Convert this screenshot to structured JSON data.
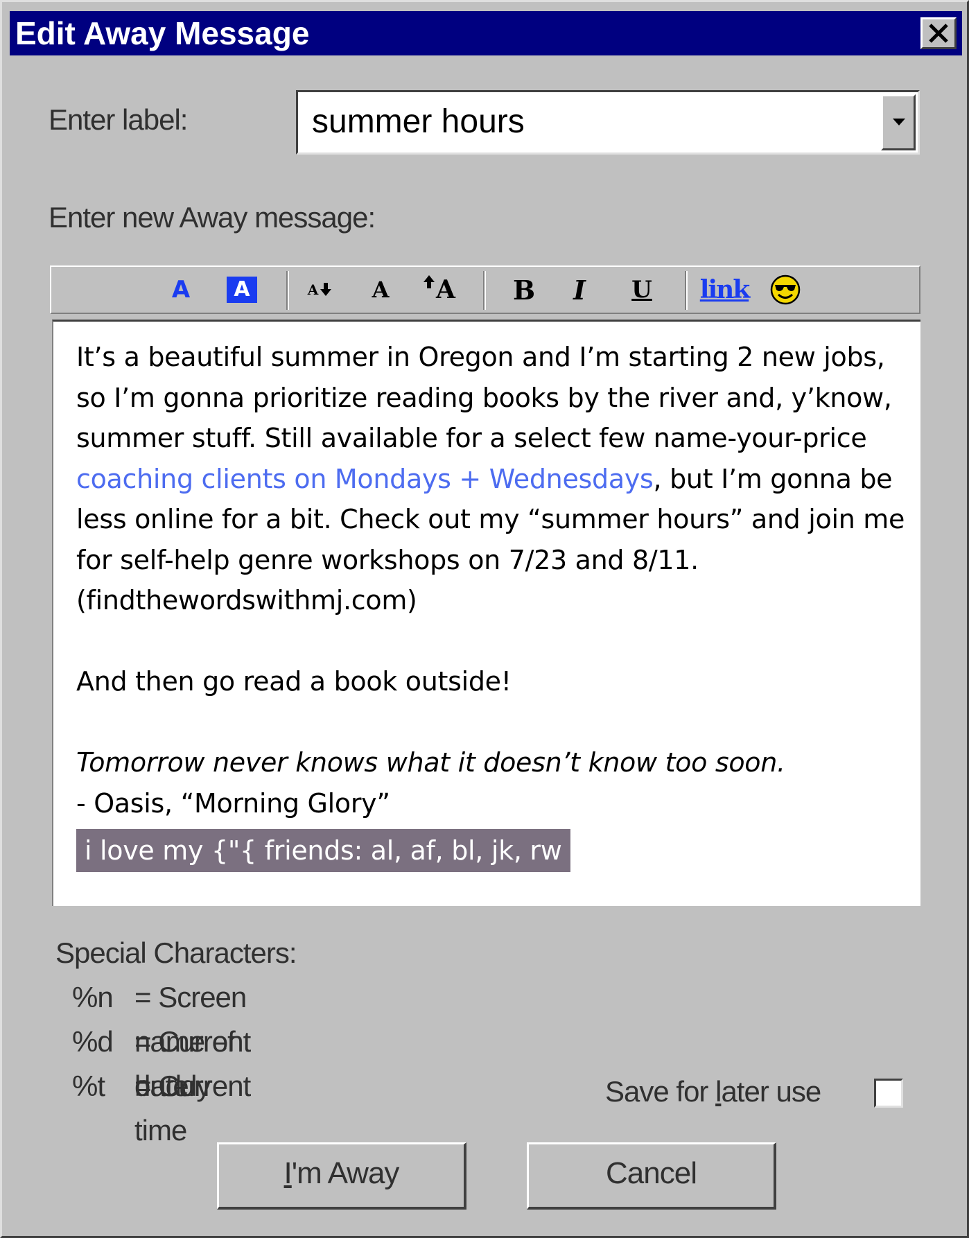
{
  "window": {
    "title": "Edit Away Message"
  },
  "label_field": {
    "caption": "Enter label:",
    "value": "summer hours"
  },
  "message_caption": "Enter new Away message:",
  "toolbar": {
    "text_color": "A",
    "bg_color": "A",
    "smaller_font": "A",
    "normal_font": "A",
    "larger_font": "A",
    "bold": "B",
    "italic": "I",
    "underline": "U",
    "link": "link"
  },
  "message": {
    "para1_a": "It’s a beautiful summer in Oregon and I’m starting 2 new jobs, so I’m gonna prioritize reading books by the river and, y’know, summer stuff. Still available for a select few name-your-price ",
    "para1_link": "coaching clients on Mondays + Wednesdays",
    "para1_b": ", but I’m gonna be less online for a bit. Check out my “summer hours” and join me for self-help genre workshops on 7/23 and 8/11. (findthewordswithmj.com)",
    "para2": "And then go read a book outside!",
    "quote_line": "Tomorrow never knows what it doesn’t know too soon.",
    "quote_attr": "- Oasis, “Morning Glory”",
    "tagline": "i love my {\"{ friends: al, af, bl, jk, rw"
  },
  "special": {
    "heading": "Special Characters:",
    "items": [
      {
        "code": "%n",
        "desc": "= Screen name of buddy"
      },
      {
        "code": "%d",
        "desc": "= Current date"
      },
      {
        "code": "%t",
        "desc": "= Current time"
      }
    ]
  },
  "save_later": {
    "pre": "Save for ",
    "accel": "l",
    "post": "ater use"
  },
  "buttons": {
    "away_accel": "I",
    "away_rest": "'m Away",
    "cancel": "Cancel"
  },
  "colors": {
    "titlebar": "#000080",
    "face": "#c0c0c0",
    "link_text": "#4d6cf0",
    "tag_bg": "#7b7080"
  }
}
